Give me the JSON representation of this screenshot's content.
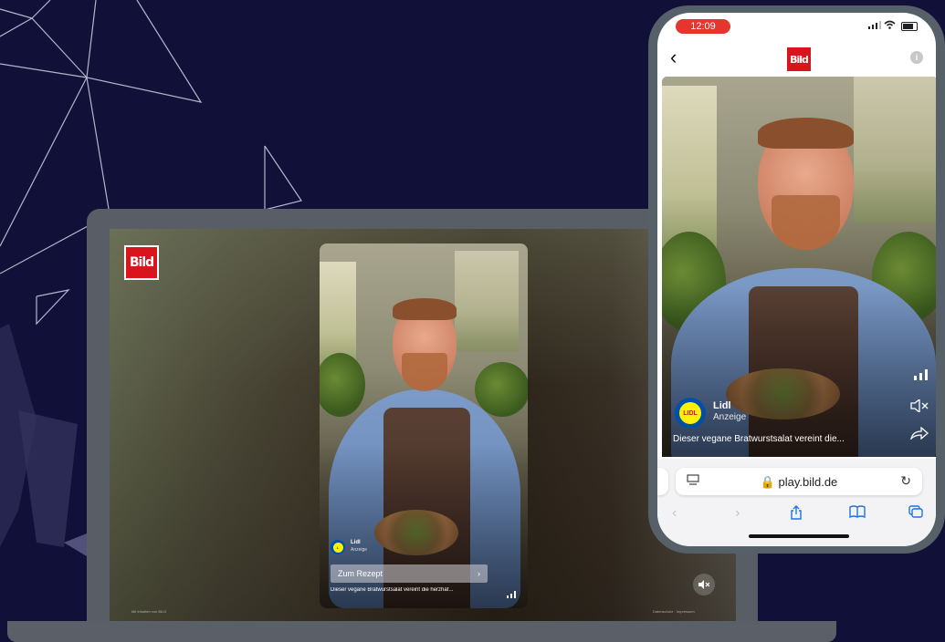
{
  "laptop": {
    "logo": "Bild",
    "card": {
      "brand_name": "Lidl",
      "brand_sub": "Anzeige",
      "cta_label": "Zum Rezept",
      "cta_arrow": "›",
      "caption": "Dieser vegane Bratwurstsalat vereint die herzhaf...",
      "brand_icon": "lidl-logo",
      "stats_icon": "bar-chart-icon"
    },
    "footer_left": "Mit Inhalten von BILD",
    "footer_right": "Datenschutz · Impressum",
    "mute_icon": "speaker-muted-icon"
  },
  "phone": {
    "status": {
      "time": "12:09",
      "signal": "signal-icon",
      "wifi": "wifi-icon",
      "battery": "battery-icon"
    },
    "nav": {
      "back": "‹",
      "logo": "Bild",
      "info": "i"
    },
    "video": {
      "brand_name": "Lidl",
      "brand_sub": "Anzeige",
      "brand_mark": "LIDL",
      "caption": "Dieser vegane Bratwurstsalat vereint die...",
      "stats_icon": "ııl",
      "mute_icon": "🔇",
      "share_icon": "➦"
    },
    "browser": {
      "url": "🔒 play.bild.de",
      "tabs_icon": "⌧",
      "reload_icon": "↻",
      "toolbar": {
        "back": "‹",
        "forward": "›",
        "share": "⇪",
        "bookmarks": "📖",
        "tabs": "⧉"
      }
    }
  }
}
